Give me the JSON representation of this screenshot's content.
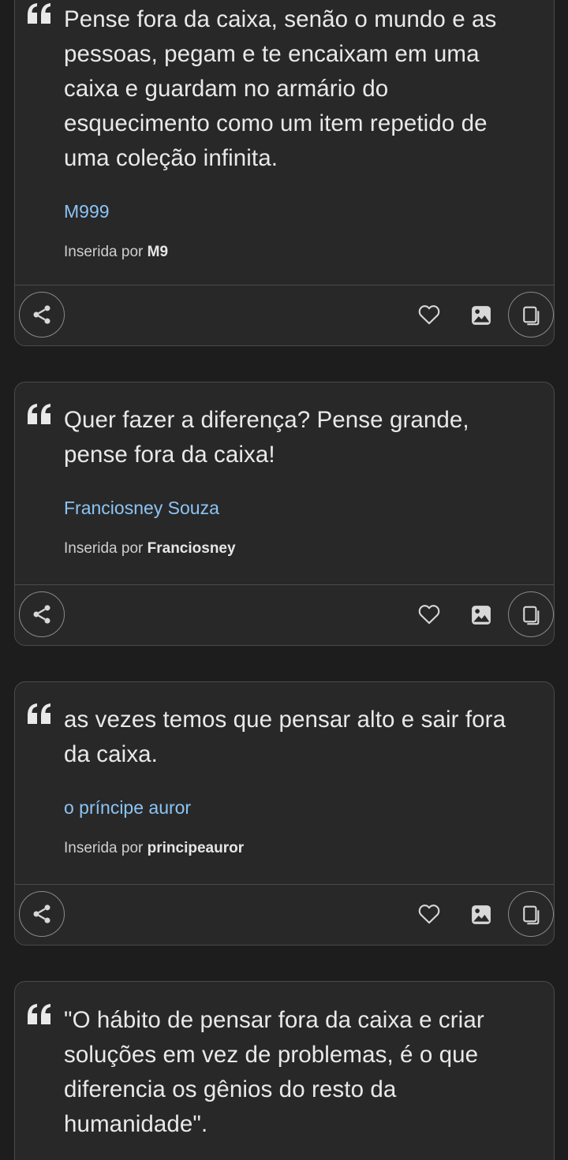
{
  "quotes": [
    {
      "text": "Pense fora da caixa, senão o mundo e as pessoas, pegam e te encaixam em uma caixa e guardam no armário do esquecimento como um item repetido de uma coleção infinita.",
      "author": "M999",
      "inserted_prefix": "Inserida por",
      "inserted_by": "M9"
    },
    {
      "text": "Quer fazer a diferença? Pense grande, pense fora da caixa!",
      "author": "Franciosney Souza",
      "inserted_prefix": "Inserida por",
      "inserted_by": "Franciosney"
    },
    {
      "text": "as vezes temos que pensar alto e sair fora da caixa.",
      "author": "o príncipe auror",
      "inserted_prefix": "Inserida por",
      "inserted_by": "principeauror"
    },
    {
      "text": "\"O hábito de pensar fora da caixa e criar soluções em vez de problemas, é o que diferencia os gênios do resto da humanidade\"."
    }
  ],
  "icons": {
    "quote": "quote-mark-icon",
    "share": "share-icon",
    "favorite": "heart-icon",
    "image": "image-icon",
    "copy": "copy-icon"
  },
  "colors": {
    "background": "#1d1d1d",
    "card": "#282828",
    "border": "#4a4a4a",
    "text": "#e9e9e9",
    "author_link": "#8cc4f4",
    "icon": "#d8d8d8"
  }
}
